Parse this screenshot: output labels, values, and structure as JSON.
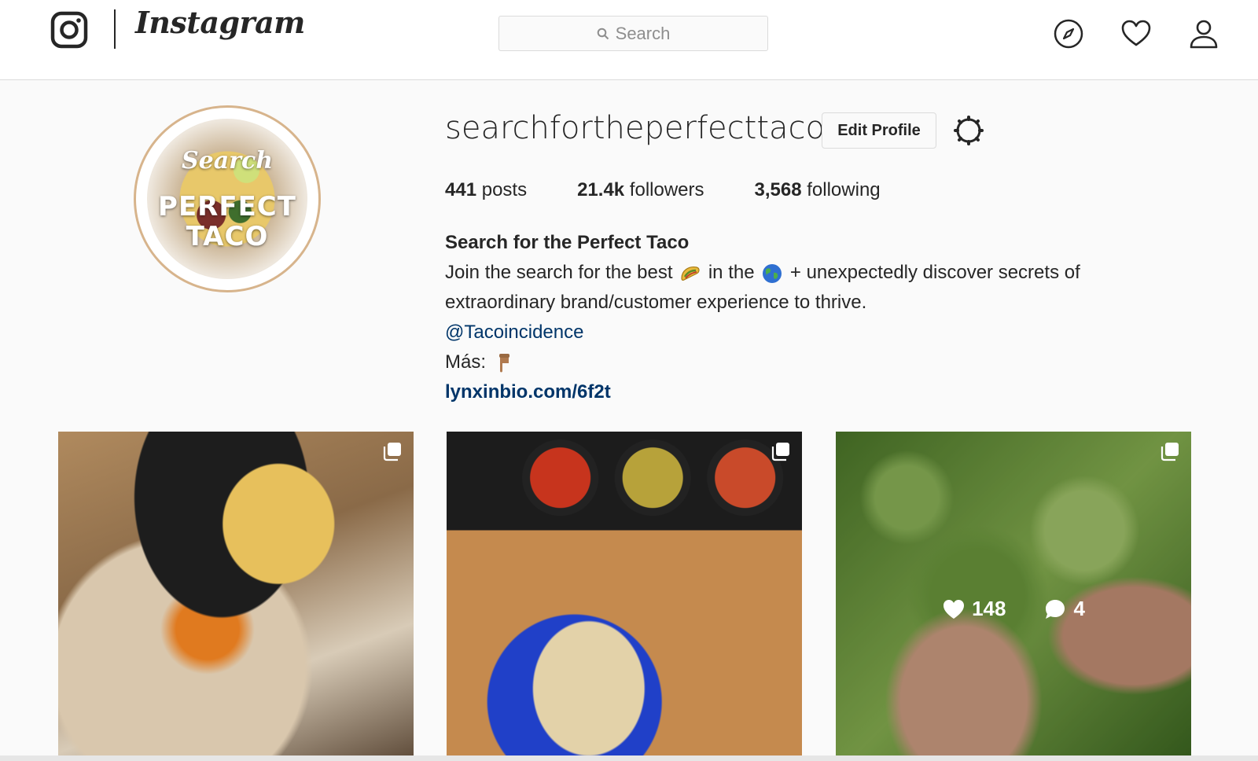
{
  "nav": {
    "wordmark": "Instagram",
    "search_placeholder": "Search",
    "icons": [
      "instagram-glyph-icon",
      "search-icon",
      "explore-compass-icon",
      "activity-heart-icon",
      "profile-person-icon"
    ]
  },
  "profile": {
    "username": "searchfortheperfecttaco",
    "edit_button_label": "Edit Profile",
    "avatar_text_line1": "Search",
    "avatar_text_line2": "PERFECT",
    "avatar_text_line3": "TACO",
    "stats": {
      "posts_count": "441",
      "posts_label": " posts",
      "followers_count": "21.4k",
      "followers_label": " followers",
      "following_count": "3,568",
      "following_label": " following"
    },
    "bio": {
      "name": "Search for the Perfect Taco",
      "line1_a": "Join the search for the best ",
      "line1_b": " in the ",
      "line1_c": " + unexpectedly discover secrets of",
      "line2": "extraordinary brand/customer experience to thrive.",
      "mention": "@Tacoincidence",
      "mas_label": "Más: ",
      "url": "lynxinbio.com/6f2t"
    }
  },
  "posts": [
    {
      "type": "carousel"
    },
    {
      "type": "carousel"
    },
    {
      "type": "carousel",
      "likes": "148",
      "comments": "4"
    }
  ],
  "colors": {
    "link": "#003569",
    "border": "#dbdbdb",
    "background": "#fafafa"
  }
}
